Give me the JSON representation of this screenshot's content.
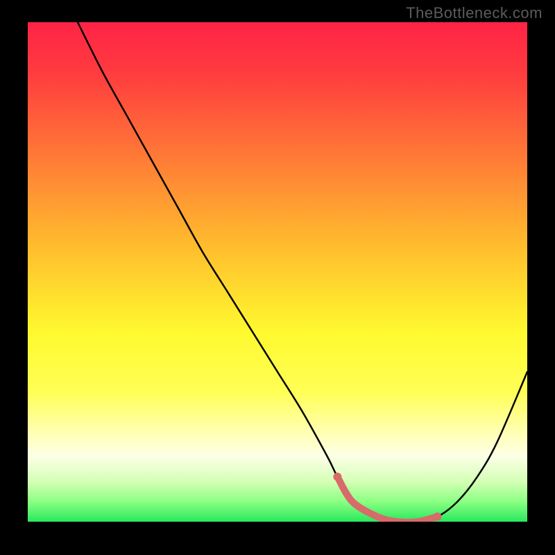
{
  "watermark": "TheBottleneck.com",
  "chart_data": {
    "type": "line",
    "title": "",
    "xlabel": "",
    "ylabel": "",
    "xlim": [
      0,
      100
    ],
    "ylim": [
      0,
      100
    ],
    "series": [
      {
        "name": "bottleneck-curve",
        "x": [
          10,
          15,
          20,
          25,
          30,
          35,
          40,
          45,
          50,
          55,
          60,
          62,
          65,
          70,
          74,
          78,
          82,
          86,
          90,
          94,
          100
        ],
        "y": [
          100,
          90,
          81,
          72,
          63,
          54,
          46,
          38,
          30,
          22,
          13,
          9,
          4,
          1,
          0,
          0,
          1,
          4,
          9,
          16,
          30
        ]
      },
      {
        "name": "highlight-flat-zone",
        "x": [
          62,
          65,
          70,
          74,
          78,
          82
        ],
        "y": [
          9,
          4,
          1,
          0,
          0,
          1
        ]
      }
    ],
    "annotations": []
  },
  "colors": {
    "curve": "#000000",
    "highlight": "#d76a6a",
    "background_top": "#ff2346",
    "background_bottom": "#28e85e"
  }
}
